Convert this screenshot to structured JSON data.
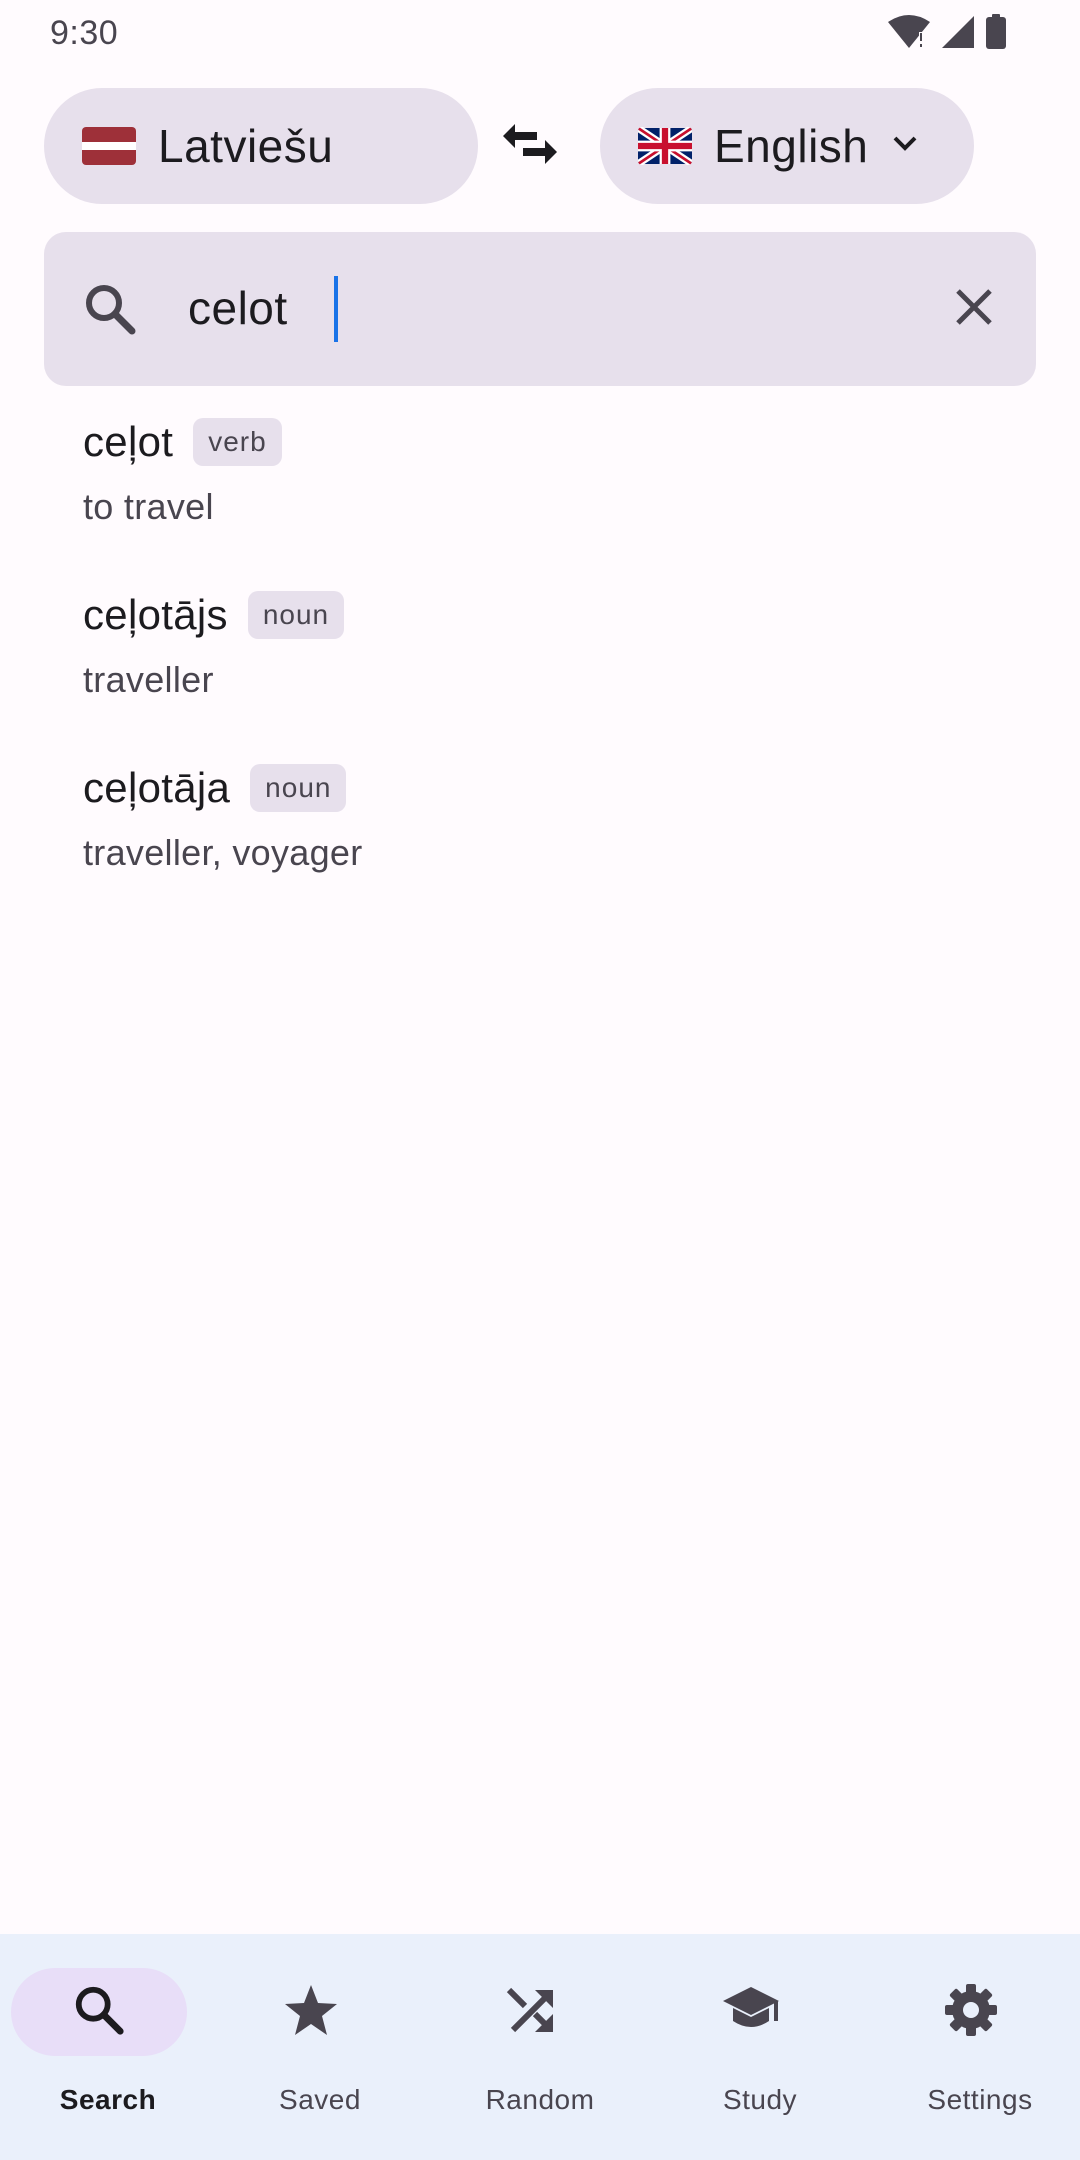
{
  "status_bar": {
    "time": "9:30"
  },
  "languages": {
    "source": {
      "name": "Latviešu",
      "flag": "latvia-flag"
    },
    "target": {
      "name": "English",
      "flag": "uk-flag"
    }
  },
  "search": {
    "value": "celot",
    "placeholder": ""
  },
  "results": [
    {
      "word": "ceļot",
      "pos": "verb",
      "definition": "to travel"
    },
    {
      "word": "ceļotājs",
      "pos": "noun",
      "definition": "traveller"
    },
    {
      "word": "ceļotāja",
      "pos": "noun",
      "definition": "traveller, voyager"
    }
  ],
  "nav": {
    "items": [
      {
        "label": "Search",
        "icon": "search-icon",
        "active": true
      },
      {
        "label": "Saved",
        "icon": "star-icon",
        "active": false
      },
      {
        "label": "Random",
        "icon": "shuffle-icon",
        "active": false
      },
      {
        "label": "Study",
        "icon": "graduation-cap-icon",
        "active": false
      },
      {
        "label": "Settings",
        "icon": "gear-icon",
        "active": false
      }
    ]
  },
  "colors": {
    "background": "#fffbfe",
    "chip": "#e7e0ec",
    "nav_background": "#eaf0fb",
    "nav_active": "#e8def8",
    "caret": "#1a73e8"
  }
}
